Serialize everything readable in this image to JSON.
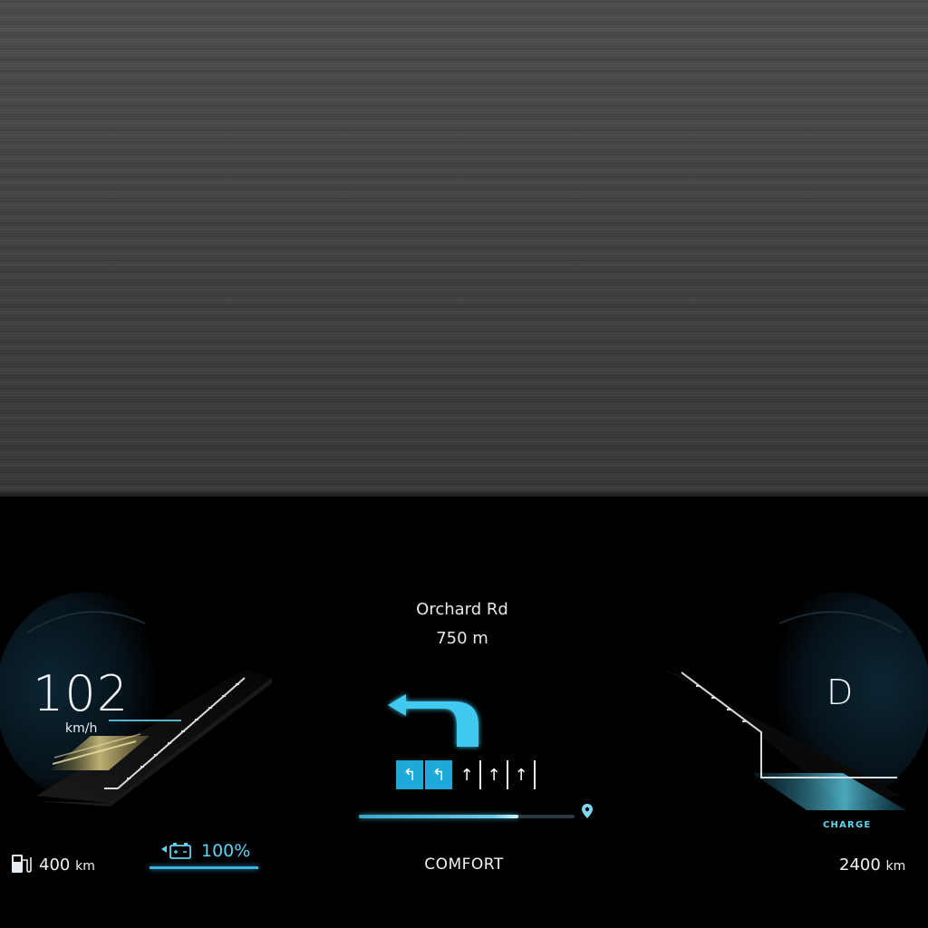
{
  "navigation": {
    "street_name": "Orchard Rd",
    "distance": "750 m",
    "turn_icon": "turn-left-arrow-icon",
    "lanes": [
      {
        "type": "left-turn",
        "active": true
      },
      {
        "type": "left-turn",
        "active": true
      },
      {
        "type": "straight",
        "active": false
      },
      {
        "type": "straight",
        "active": false
      },
      {
        "type": "straight",
        "active": false
      }
    ],
    "route_progress": 0.74
  },
  "speedometer": {
    "value": "102",
    "unit": "km/h"
  },
  "gear": {
    "value": "D"
  },
  "power_gauge": {
    "label": "CHARGE"
  },
  "drive_mode": {
    "label": "COMFORT"
  },
  "fuel_range": {
    "value": "400",
    "unit": "km",
    "icon": "fuel-pump-icon"
  },
  "battery": {
    "value": "100%",
    "icon": "battery-icon"
  },
  "total_range": {
    "value": "2400",
    "unit": "km"
  },
  "colors": {
    "accent": "#1fa9da",
    "text": "#f0f3f5",
    "speed_glow": "#e8d48a",
    "charge_glow": "#5fd8f2"
  }
}
